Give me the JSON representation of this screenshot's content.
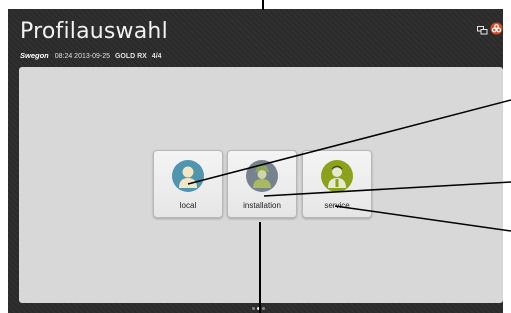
{
  "header": {
    "title": "Profilauswahl",
    "brand": "Swegon",
    "datetime": "08:24 2013-09-25",
    "model": "GOLD RX",
    "pages": "4/4"
  },
  "icons": {
    "screen_switch": "screen-switch-icon",
    "alarm": "alarm-icon"
  },
  "profiles": [
    {
      "label": "local",
      "color": "#4e95ad"
    },
    {
      "label": "installation",
      "color": "#76828d"
    },
    {
      "label": "service",
      "color": "#8ca21a"
    }
  ],
  "colors": {
    "alarm": "#e04a1f",
    "background": "#2b2b2b",
    "panel": "#d8d8d8"
  }
}
